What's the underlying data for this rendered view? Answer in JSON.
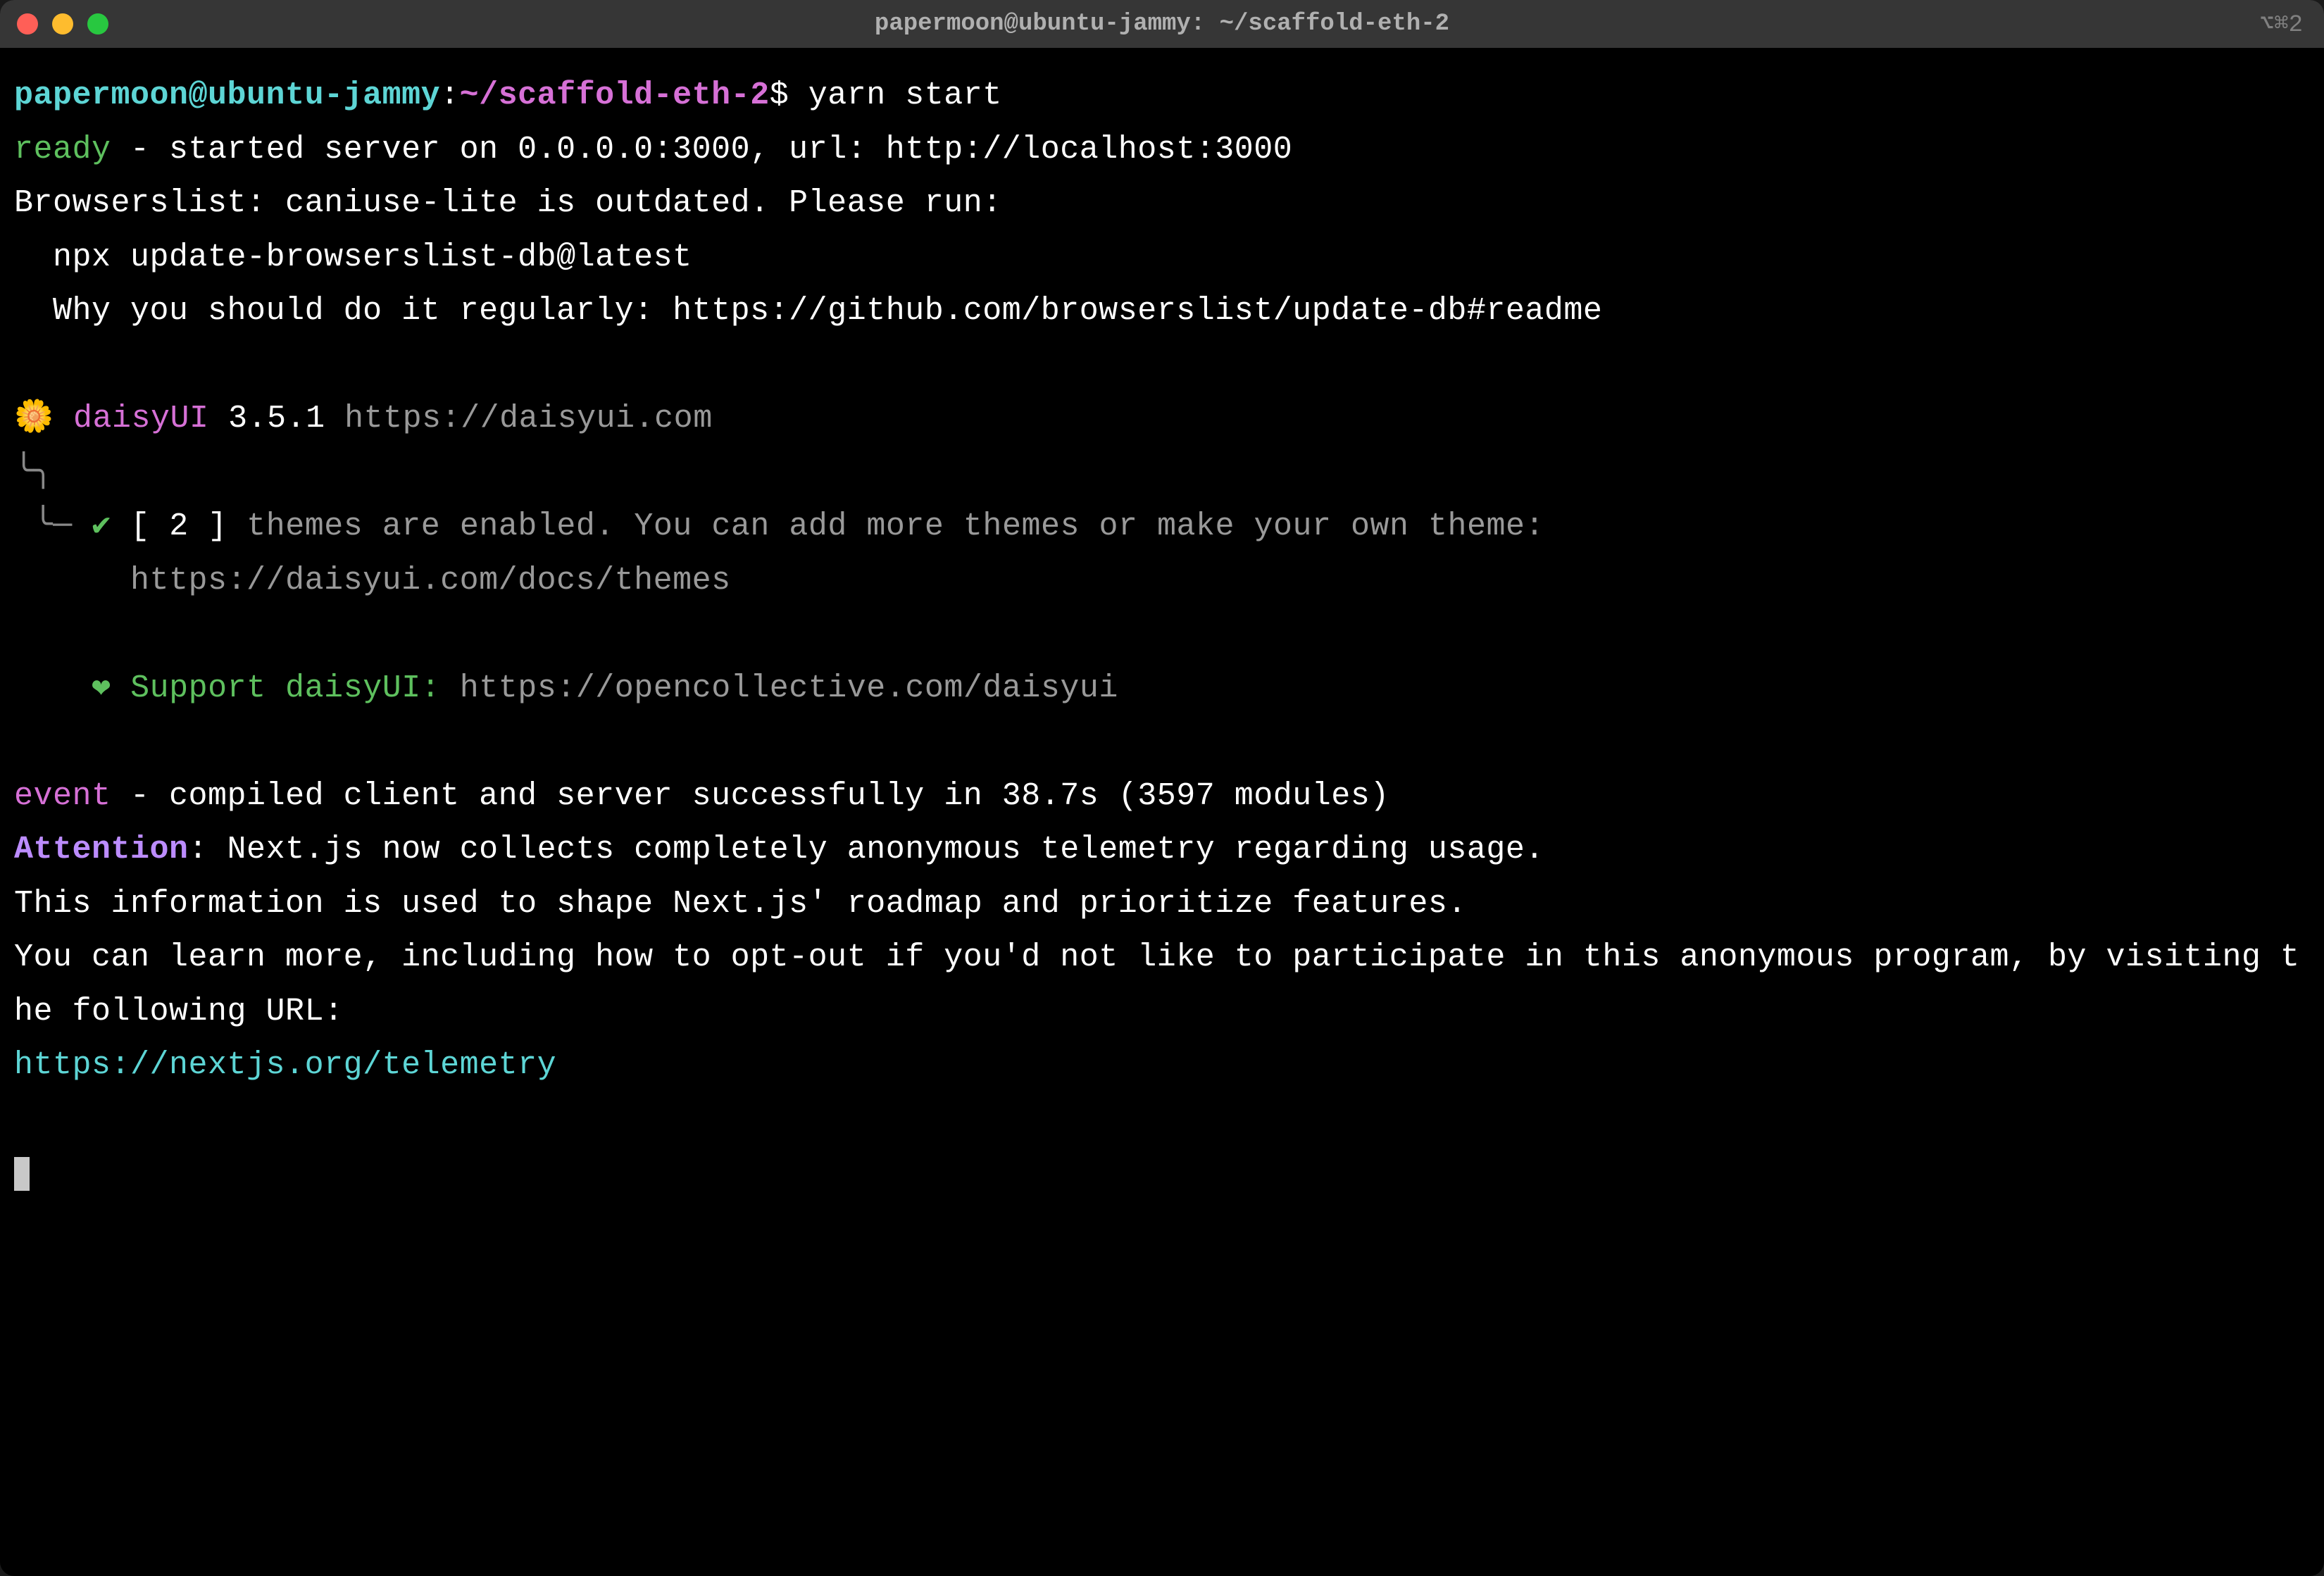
{
  "titlebar": {
    "title": "papermoon@ubuntu-jammy: ~/scaffold-eth-2",
    "shortcut": "⌥⌘2"
  },
  "prompt": {
    "user_host": "papermoon@ubuntu-jammy",
    "separator1": ":",
    "path": "~/scaffold-eth-2",
    "separator2": "$ ",
    "command": "yarn start"
  },
  "lines": {
    "ready_label": "ready",
    "ready_text": " - started server on 0.0.0.0:3000, url: http://localhost:3000",
    "browserslist1": "Browserslist: caniuse-lite is outdated. Please run:",
    "browserslist2": "  npx update-browserslist-db@latest",
    "browserslist3": "  Why you should do it regularly: https://github.com/browserslist/update-db#readme",
    "daisy_emoji": "🌼",
    "daisy_name": " daisyUI",
    "daisy_version": " 3.5.1 ",
    "daisy_url": "https://daisyui.com",
    "tree1": "╰╮",
    "tree2": " ╰─ ",
    "check": "✔ ",
    "themes_count": "[ 2 ]",
    "themes_text": " themes are enabled. You can add more themes or make your own theme:",
    "themes_url": "      https://daisyui.com/docs/themes",
    "support_indent": "    ",
    "support_heart": "❤︎ ",
    "support_label": "Support daisyUI: ",
    "support_url": "https://opencollective.com/daisyui",
    "event_label": "event",
    "event_text": " - compiled client and server successfully in 38.7s (3597 modules)",
    "attention_label": "Attention",
    "attention_text": ": Next.js now collects completely anonymous telemetry regarding usage.",
    "telemetry2": "This information is used to shape Next.js' roadmap and prioritize features.",
    "telemetry3": "You can learn more, including how to opt-out if you'd not like to participate in this anonymous program, by visiting the following URL:",
    "telemetry_url": "https://nextjs.org/telemetry"
  }
}
